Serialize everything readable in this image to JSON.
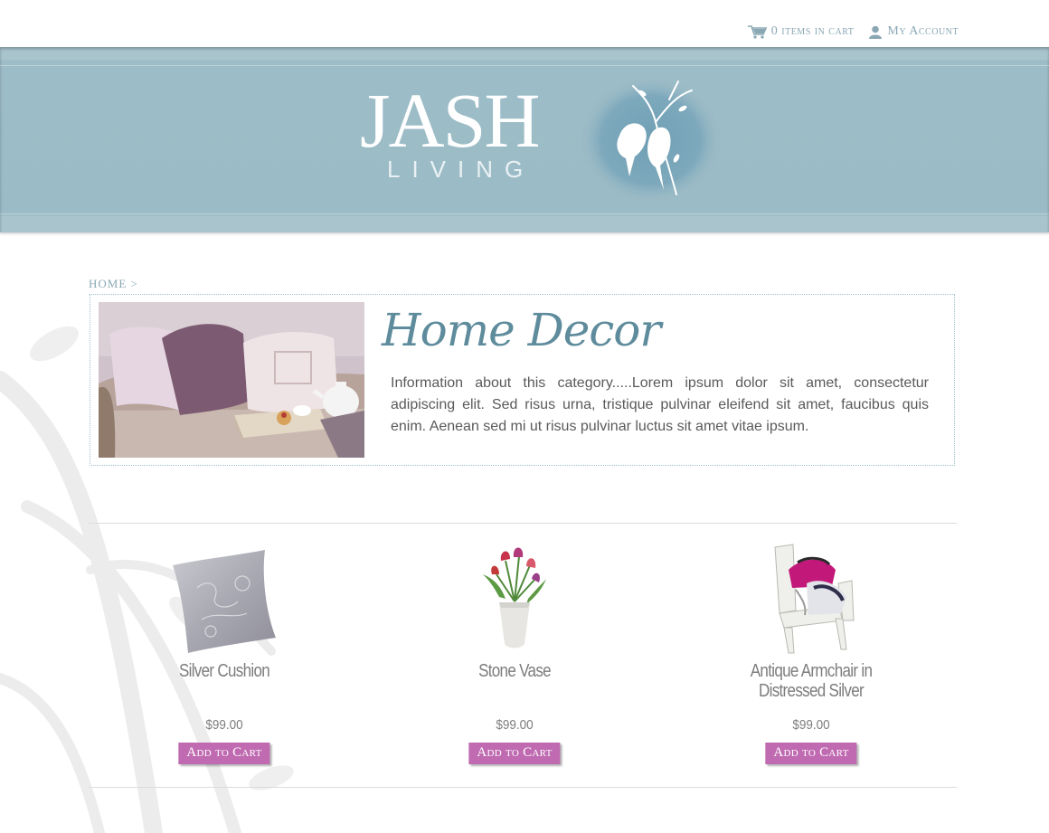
{
  "header": {
    "cart_label": "0 items in cart",
    "account_label": "My Account",
    "logo_main": "JASH",
    "logo_sub": "LIVING"
  },
  "breadcrumb": {
    "home": "HOME",
    "separator": ">"
  },
  "category": {
    "title": "Home Decor",
    "description": "Information about this category.....Lorem ipsum dolor sit amet, consectetur adipiscing elit. Sed risus urna, tristique pulvinar eleifend sit amet, faucibus quis enim. Aenean sed mi ut risus pulvinar luctus sit amet vitae ipsum."
  },
  "products": [
    {
      "name": "Silver Cushion",
      "price": "$99.00",
      "button": "Add to Cart"
    },
    {
      "name": "Stone Vase",
      "price": "$99.00",
      "button": "Add to Cart"
    },
    {
      "name": "Antique Armchair in Distressed Silver",
      "price": "$99.00",
      "button": "Add to Cart"
    }
  ],
  "colors": {
    "header_band": "#9bbbc6",
    "accent_text": "#8aa7b4",
    "button": "#c06bb1"
  },
  "icons": {
    "cart": "shopping-cart-icon",
    "account": "user-icon"
  }
}
